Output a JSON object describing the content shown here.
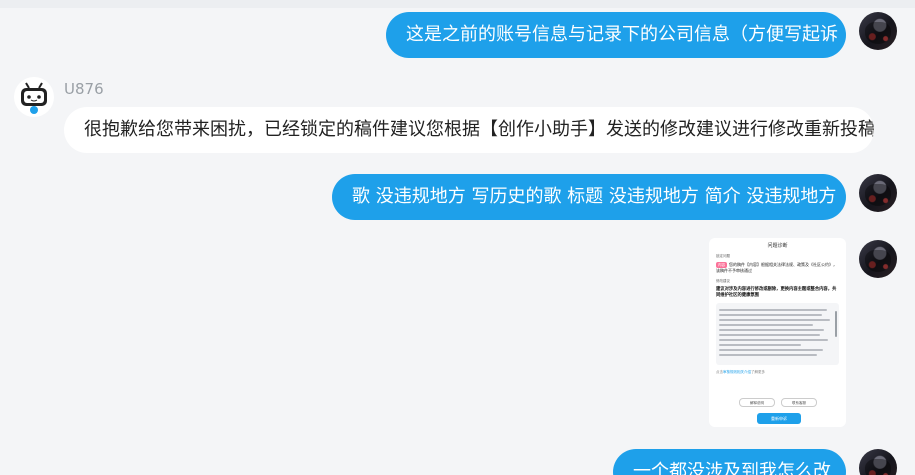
{
  "messages": [
    {
      "side": "right",
      "text": "这是之前的账号信息与记录下的公司信息（方便写起诉"
    },
    {
      "side": "left",
      "username": "U876",
      "text": "很抱歉给您带来困扰，已经锁定的稿件建议您根据【创作小助手】发送的修改建议进行修改重新投稿"
    },
    {
      "side": "right",
      "text": "歌 没违规地方 写历史的歌 标题 没违规地方 简介 没违规地方"
    },
    {
      "side": "right",
      "text": "一个都没涉及到我怎么改"
    }
  ],
  "screenshot_doc": {
    "title": "问题诊断",
    "section1": "锁定问题",
    "tag": "内容",
    "warning": "您的稿件【内容】根据相关法律法规、政策及《社区公约》，该稿件不予审核通过",
    "section2": "修改建议",
    "suggestion": "建议对涉及内容进行修改或删除，更换内容主题或整合内容，共同维护社区的健康氛围",
    "footer_text": "点击",
    "footer_link": "审核规则相关介绍",
    "footer_suffix": "了解更多",
    "btn_left": "解释说明",
    "btn_right": "联系客服",
    "main_button": "重新申诉"
  }
}
